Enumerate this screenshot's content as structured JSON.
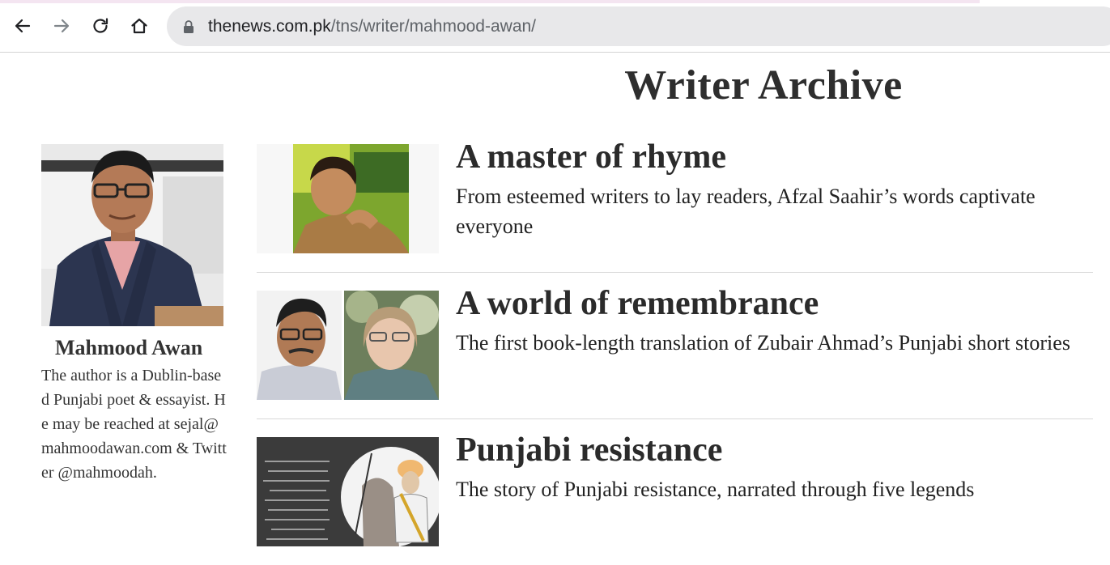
{
  "browser": {
    "url_host": "thenews.com.pk",
    "url_path": "/tns/writer/mahmood-awan/",
    "icons": [
      "back-icon",
      "forward-icon",
      "reload-icon",
      "home-icon",
      "lock-icon"
    ]
  },
  "page": {
    "title": "Writer Archive"
  },
  "author": {
    "name": "Mahmood Awan",
    "bio": "The author is a Dublin-based Punjabi poet & essayist. He may be reached at sejal@mahmoodawan.com & Twitter @mahmoodah."
  },
  "articles": [
    {
      "headline": "A master of rhyme",
      "summary": "From esteemed writers to lay readers, Afzal Saahir’s words captivate everyone"
    },
    {
      "headline": "A world of remembrance",
      "summary": "The first book-length translation of Zubair Ahmad’s Punjabi short stories"
    },
    {
      "headline": "Punjabi resistance",
      "summary": "The story of Punjabi resistance, narrated through five legends"
    }
  ],
  "colors": {
    "headline": "#2b2b2b",
    "omnibox": "#e8e8ea",
    "divider": "#d9d9d9"
  }
}
